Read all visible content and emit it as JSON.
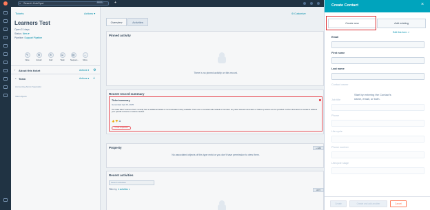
{
  "topbar": {
    "search_placeholder": "Search HubSpot",
    "shortcut": "Ctrl K"
  },
  "record": {
    "back_label": "Tickets",
    "actions_label": "Actions ▾",
    "name": "Learners Test",
    "open_label": "Open 21 days",
    "status_label": "Status:",
    "status_value": "New ▾",
    "pipeline_label": "Pipeline:",
    "pipeline_value": "Support Pipeline",
    "quick_actions": [
      {
        "label": "Note",
        "icon": "note-icon",
        "glyph": "✎"
      },
      {
        "label": "Email",
        "icon": "email-icon",
        "glyph": "✉"
      },
      {
        "label": "Call",
        "icon": "call-icon",
        "glyph": "✆"
      },
      {
        "label": "Task",
        "icon": "task-icon",
        "glyph": "☑"
      },
      {
        "label": "Sequen...",
        "icon": "sequence-icon",
        "glyph": "▤"
      },
      {
        "label": "More",
        "icon": "more-icon",
        "glyph": "…"
      }
    ],
    "about_label": "About this ticket",
    "about_actions": "Actions ▾",
    "team_label": "Team",
    "team_actions": "Actions ▾",
    "team_member": "Accounting Admin Specialist",
    "team_note": "Valid objects"
  },
  "center": {
    "customize_label": "⚙ Customize",
    "tabs": [
      "Overview",
      "Activities"
    ],
    "pinned_title": "Pinned activity",
    "pinned_empty": "There is no pinned activity on this record.",
    "summary_title": "Recent record summary",
    "summary_card_title": "Ticket summary",
    "summary_date": "Generated Apr 25, 2025",
    "summary_body": "The ticket titled \"Learners Test\" currently has no additional details or communication history available. There are no recorded calls related to this ticket. Any other relevant information or follow-up actions are not provided. Further information is needed to address your specific concerns or actions needed.",
    "summary_button": "✦ Ask a question",
    "property_title": "Property",
    "property_add": "+ Add",
    "property_empty": "No associated objects of this type exist or you don't have permission to view them.",
    "recent_title": "Recent activities",
    "recent_search_placeholder": "Search activities",
    "filter_label": "Filter by:",
    "filter_value": "4 activities ▾",
    "collapse_all": "All ▾"
  },
  "panel": {
    "title": "Create Contact",
    "close": "×",
    "seg_create": "Create new",
    "seg_existing": "Add existing",
    "edit_form": "Edit this form ↗",
    "fields": [
      {
        "label": "Email",
        "dim": false
      },
      {
        "label": "First name",
        "dim": false
      },
      {
        "label": "Last name",
        "dim": false
      },
      {
        "label": "Contact owner",
        "dim": true
      },
      {
        "label": "Job title",
        "dim": true
      },
      {
        "label": "Phone",
        "dim": true
      },
      {
        "label": "Life cycle",
        "dim": true
      },
      {
        "label": "Phone number",
        "dim": true
      },
      {
        "label": "Lifecycle stage",
        "dim": true
      }
    ],
    "hint": "Start by entering the Contact's name, email, or both.",
    "btn_create": "Create",
    "btn_create_add": "Create and add another",
    "btn_cancel": "Cancel"
  },
  "colors": {
    "accent": "#00a4bd",
    "link": "#0091ae",
    "brand": "#ff7a59",
    "nav": "#213343",
    "highlight": "#d9262a"
  }
}
